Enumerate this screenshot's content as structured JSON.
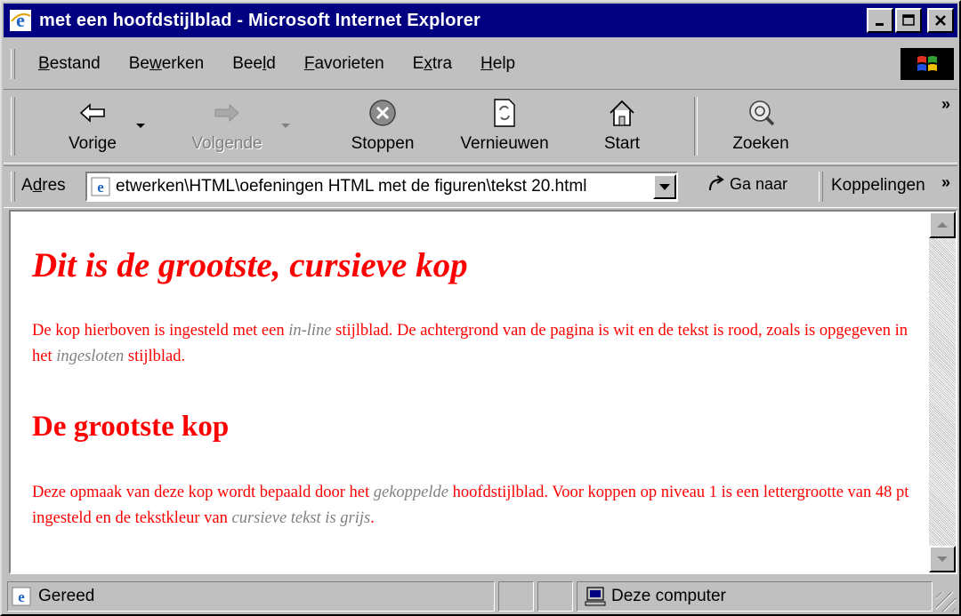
{
  "window": {
    "title": "met een hoofdstijlblad - Microsoft Internet Explorer",
    "minimize_label": "_",
    "maximize_label": "□",
    "close_label": "✕"
  },
  "menu": {
    "items": [
      {
        "accel": "B",
        "rest": "estand"
      },
      {
        "pre": "Be",
        "accel": "w",
        "rest": "erken"
      },
      {
        "pre": "Bee",
        "accel": "l",
        "rest": "d"
      },
      {
        "accel": "F",
        "rest": "avorieten"
      },
      {
        "pre": "E",
        "accel": "x",
        "rest": "tra"
      },
      {
        "accel": "H",
        "rest": "elp"
      }
    ]
  },
  "toolbar": {
    "back": "Vorige",
    "forward": "Volgende",
    "stop": "Stoppen",
    "refresh": "Vernieuwen",
    "home": "Start",
    "search": "Zoeken",
    "more": "»"
  },
  "address": {
    "label_accel": "d",
    "label_pre": "A",
    "label_rest": "res",
    "value": "etwerken\\HTML\\oefeningen HTML met de figuren\\tekst 20.html",
    "go_label": "Ga naar",
    "links_label": "Koppelingen",
    "links_more": "»"
  },
  "page": {
    "heading1": "Dit is de grootste, cursieve kop",
    "para1": {
      "a": "De kop hierboven is ingesteld met een ",
      "b": "in-line",
      "c": " stijlblad. De achtergrond van de pagina is wit en de tekst is rood, zoals is opgegeven in het ",
      "d": "ingesloten",
      "e": " stijlblad."
    },
    "heading2": "De grootste kop",
    "para2": {
      "a": "Deze opmaak van deze kop wordt bepaald door het ",
      "b": "gekoppelde",
      "c": " hoofdstijlblad. Voor koppen op niveau 1 is een lettergrootte van 48 pt ingesteld en de tekstkleur van ",
      "d": "cursieve tekst is grijs",
      "e": "."
    }
  },
  "status": {
    "text": "Gereed",
    "zone": "Deze computer"
  },
  "colors": {
    "titlebar": "#000080",
    "page_text": "#ff0000",
    "italic_text": "#808080"
  }
}
